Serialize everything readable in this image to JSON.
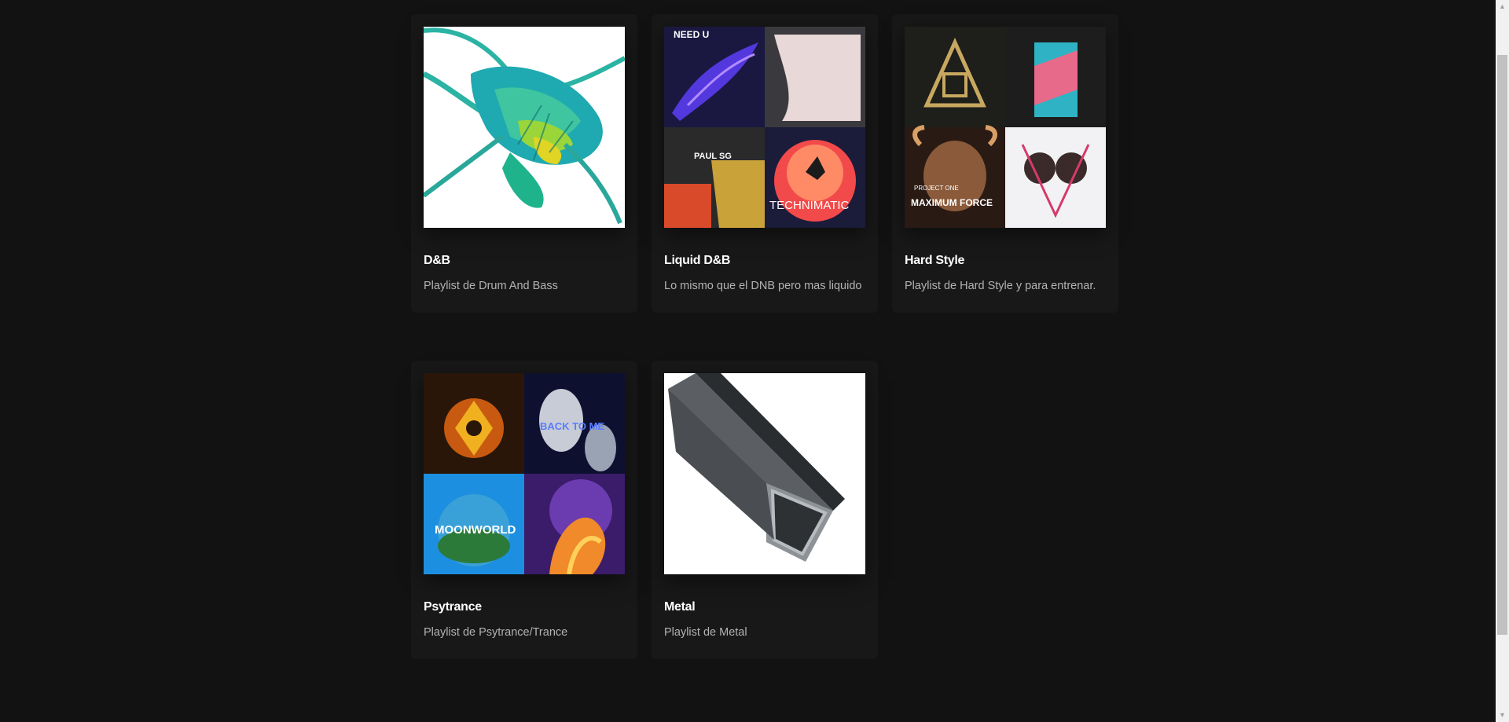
{
  "playlists": [
    {
      "title": "D&B",
      "description": "Playlist de Drum And Bass"
    },
    {
      "title": "Liquid D&B",
      "description": "Lo mismo que el DNB pero mas liquido"
    },
    {
      "title": "Hard Style",
      "description": "Playlist de Hard Style y para entrenar."
    },
    {
      "title": "Psytrance",
      "description": "Playlist de Psytrance/Trance"
    },
    {
      "title": "Metal",
      "description": "Playlist de Metal"
    }
  ],
  "cover_art": {
    "liquid": [
      "NEED U",
      "PAUL SG",
      "TECHNIMATIC"
    ],
    "hardstyle": [
      "PROJECT ONE",
      "MAXIMUM FORCE"
    ],
    "psytrance": [
      "BACK TO ME",
      "MOONWORLD"
    ]
  },
  "colors": {
    "background": "#121212",
    "card": "#181818",
    "title": "#ffffff",
    "description": "#b3b3b3"
  },
  "scrollbar": {
    "up_icon": "arrow-up-icon",
    "down_icon": "arrow-down-icon"
  }
}
